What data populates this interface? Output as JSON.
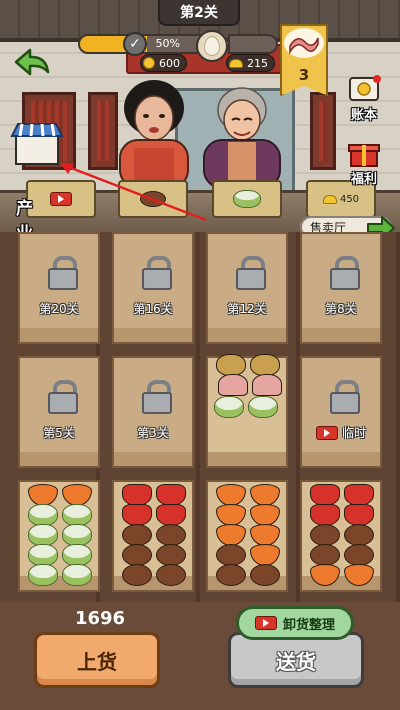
{
  "level": {
    "label": "第2关"
  },
  "progress": {
    "percent_text": "50%",
    "fill_fraction": 0.5
  },
  "goal": {
    "count": "3",
    "icon": "bacon-icon"
  },
  "currency": {
    "coins": "600",
    "ingots": "215"
  },
  "side_buttons": {
    "ledger": "账本",
    "welfare": "福利"
  },
  "industry": {
    "label": "产业"
  },
  "plates": {
    "right_price": "450"
  },
  "sale_hall": {
    "label": "售卖厅"
  },
  "slots": [
    {
      "label": "第20关",
      "locked": true
    },
    {
      "label": "第16关",
      "locked": true
    },
    {
      "label": "第12关",
      "locked": true
    },
    {
      "label": "第8关",
      "locked": true
    },
    {
      "label": "第5关",
      "locked": true
    },
    {
      "label": "第3关",
      "locked": true
    },
    {
      "label": "",
      "locked": false
    },
    {
      "label": "临时",
      "locked": true,
      "ad": true
    }
  ],
  "bottom": {
    "score": "1696",
    "load_label": "上货",
    "send_label": "送货",
    "sort_label": "卸货整理"
  },
  "colors": {
    "accent": "#f2b323",
    "sale_arrow": "#5bb53a",
    "hint_arrow": "#e02020"
  }
}
